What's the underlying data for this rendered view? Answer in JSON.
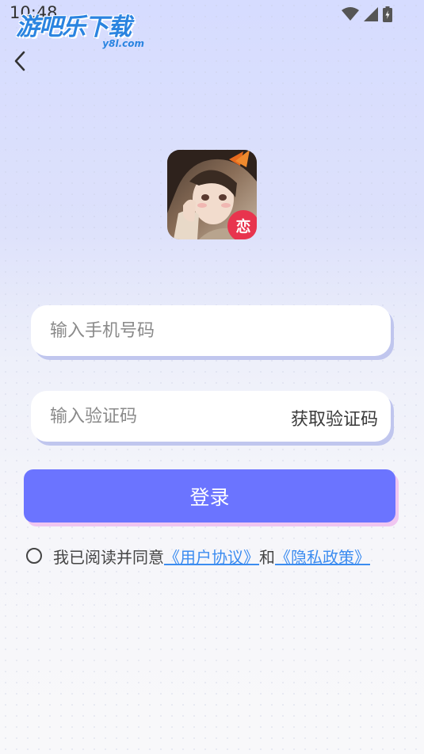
{
  "status_bar": {
    "time": "10:48"
  },
  "watermark": {
    "main": "游吧乐下载",
    "sub": "y8l.com"
  },
  "form": {
    "phone_placeholder": "输入手机号码",
    "code_placeholder": "输入验证码",
    "get_code_label": "获取验证码",
    "login_label": "登录"
  },
  "agreement": {
    "prefix": "我已阅读并同意",
    "user_agreement": "《用户协议》",
    "and": "和",
    "privacy_policy": "《隐私政策》"
  },
  "app_icon": {
    "badge": "恋"
  },
  "colors": {
    "accent": "#6b74ff",
    "link": "#3c8cf0",
    "icon_badge": "#e8344e",
    "watermark": "#2a84e0"
  }
}
